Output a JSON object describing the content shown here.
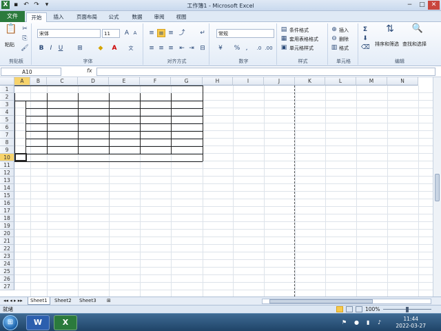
{
  "window": {
    "title": "工作簿1 - Microsoft Excel",
    "controls": {
      "minimize": "−",
      "maximize": "□",
      "close": "✕"
    }
  },
  "ribbon_tabs": [
    "文件",
    "开始",
    "插入",
    "页面布局",
    "公式",
    "数据",
    "审阅",
    "视图"
  ],
  "active_tab": "开始",
  "ribbon": {
    "clipboard": {
      "paste_label": "粘贴",
      "group_label": "剪贴板"
    },
    "font": {
      "font_name": "宋体",
      "font_size": "11",
      "bold": "B",
      "italic": "I",
      "underline": "U",
      "group_label": "字体"
    },
    "alignment": {
      "group_label": "对齐方式"
    },
    "number": {
      "format": "常规",
      "percent": "%",
      "comma": ",",
      "group_label": "数字"
    },
    "styles": {
      "conditional": "条件格式",
      "table_format": "套用表格格式",
      "cell_styles": "单元格样式",
      "group_label": "样式"
    },
    "cells": {
      "insert": "插入",
      "delete": "删除",
      "format": "格式",
      "group_label": "单元格"
    },
    "editing": {
      "sigma": "Σ",
      "sort_filter": "排序和筛选",
      "find_select": "查找和选择",
      "group_label": "编辑"
    }
  },
  "formula_bar": {
    "name_box": "A10",
    "fx": "fx",
    "value": ""
  },
  "columns": [
    "A",
    "B",
    "C",
    "D",
    "E",
    "F",
    "G",
    "H",
    "I",
    "J",
    "K",
    "L",
    "M",
    "N"
  ],
  "rows": [
    "1",
    "2",
    "3",
    "4",
    "5",
    "6",
    "7",
    "8",
    "9",
    "10",
    "11",
    "12",
    "13",
    "14",
    "15",
    "16",
    "17",
    "18",
    "19",
    "20",
    "21",
    "22",
    "23",
    "24",
    "25",
    "26",
    "27"
  ],
  "selected_cell": "A10",
  "sheets": [
    "Sheet1",
    "Sheet2",
    "Sheet3"
  ],
  "active_sheet": "Sheet1",
  "status": {
    "mode": "就绪",
    "zoom": "100%"
  },
  "taskbar": {
    "time": "11:44",
    "date": "2022-03-27",
    "apps": [
      "W",
      "X"
    ]
  },
  "colors": {
    "file_tab": "#2b7a3c",
    "selection": "#f7c94b",
    "grid": "#dde3ea"
  }
}
